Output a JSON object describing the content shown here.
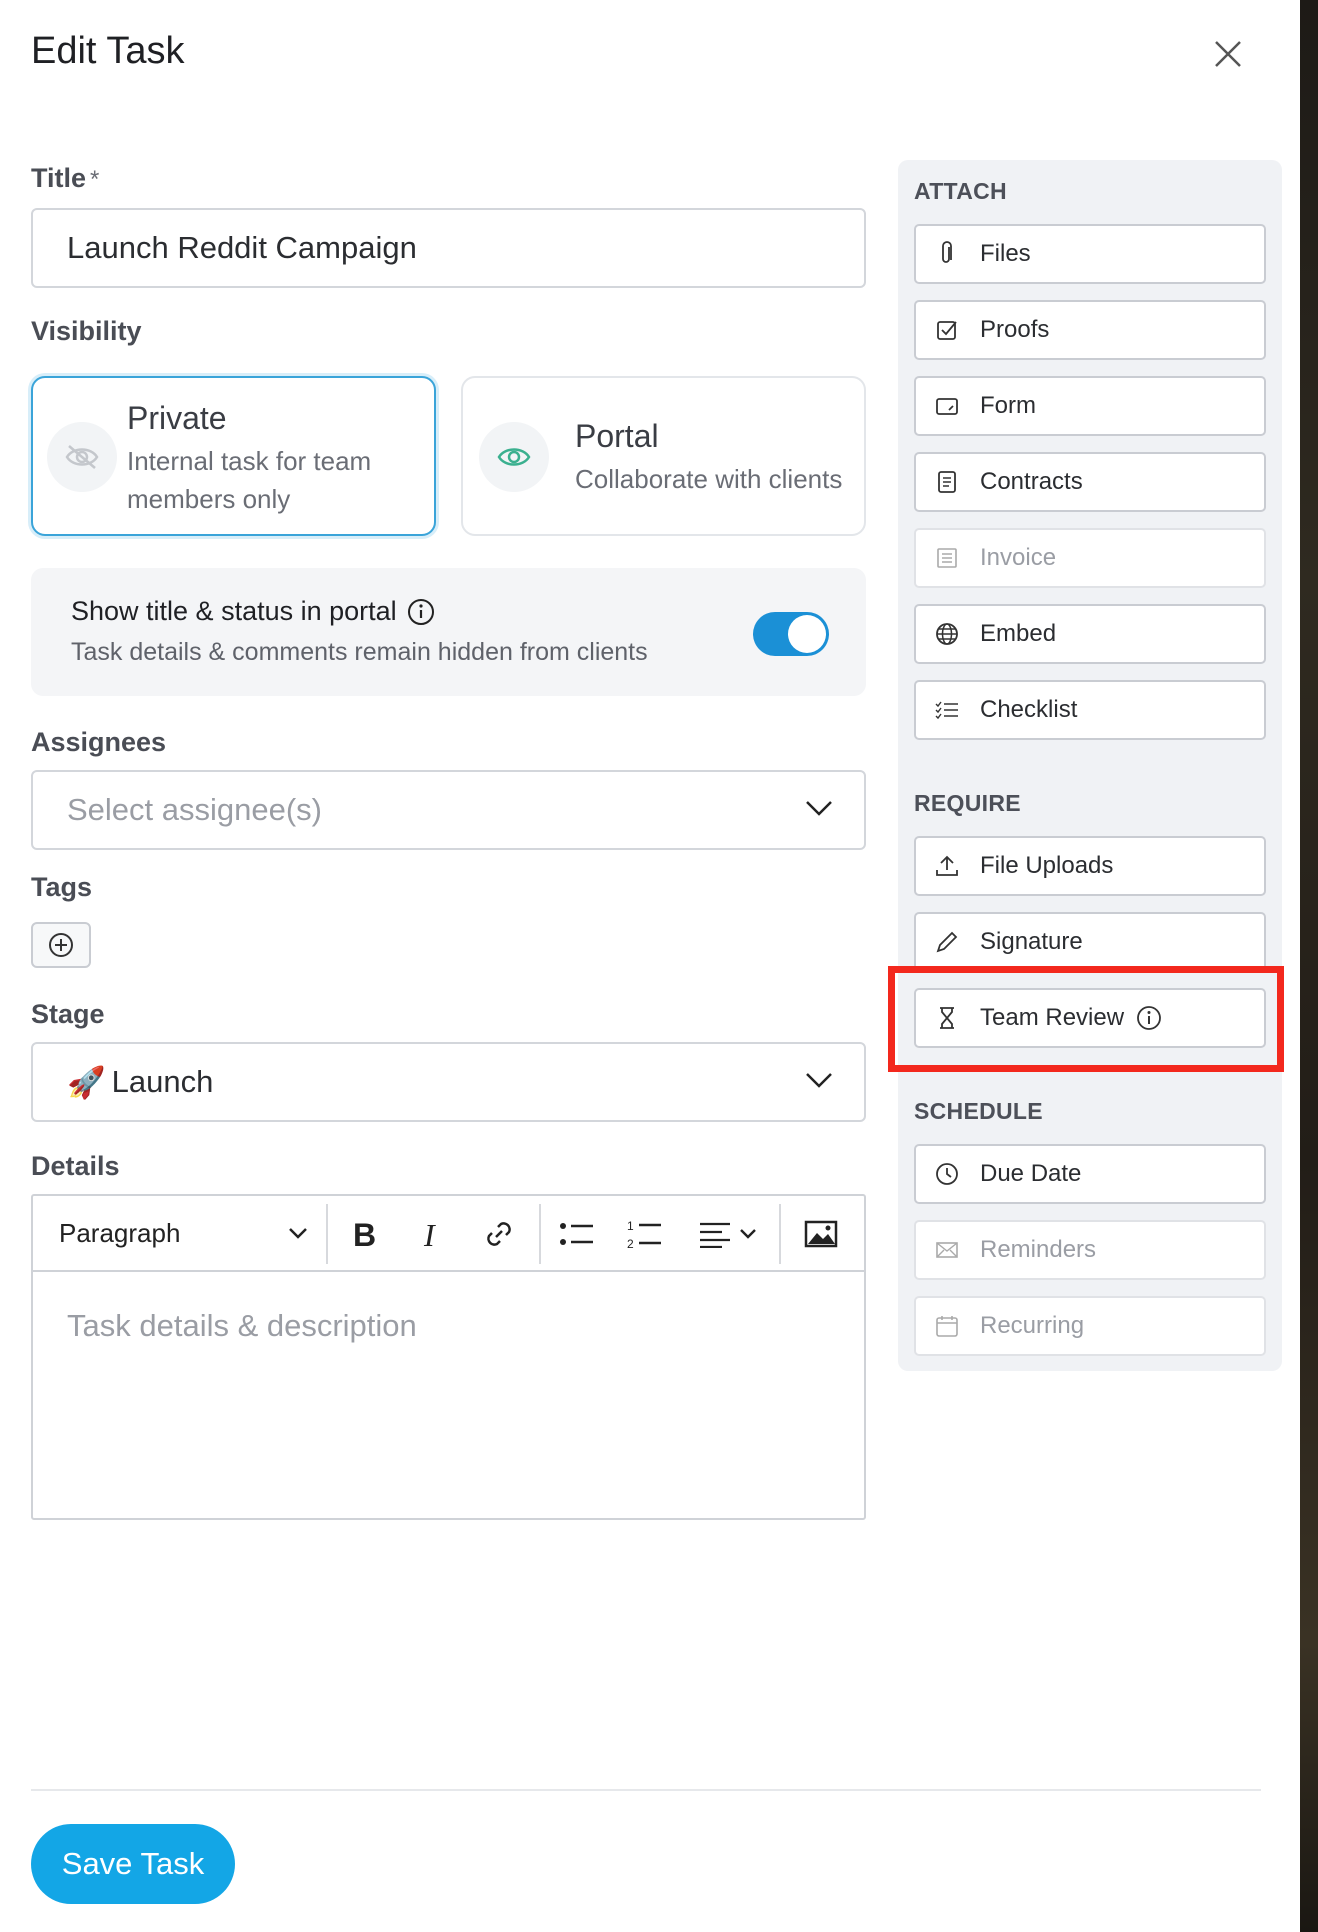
{
  "header": {
    "title": "Edit Task"
  },
  "form": {
    "title_label": "Title",
    "title_required": "*",
    "title_value": "Launch Reddit Campaign",
    "visibility_label": "Visibility",
    "visibility_options": [
      {
        "title": "Private",
        "subtitle_line1": "Internal task for team",
        "subtitle_line2": "members only",
        "selected": true
      },
      {
        "title": "Portal",
        "subtitle_line1": "Collaborate with clients",
        "selected": false
      }
    ],
    "portal_toggle": {
      "title": "Show title & status in portal",
      "subtitle": "Task details & comments remain hidden from clients",
      "on": true
    },
    "assignees_label": "Assignees",
    "assignees_placeholder": "Select assignee(s)",
    "tags_label": "Tags",
    "stage_label": "Stage",
    "stage_emoji": "🚀",
    "stage_value": "Launch",
    "details_label": "Details",
    "editor": {
      "block_format": "Paragraph",
      "placeholder": "Task details & description"
    }
  },
  "footer": {
    "save_label": "Save Task"
  },
  "sidebar": {
    "attach_heading": "ATTACH",
    "attach_items": [
      {
        "label": "Files",
        "icon": "paperclip-icon",
        "enabled": true
      },
      {
        "label": "Proofs",
        "icon": "proof-check-icon",
        "enabled": true
      },
      {
        "label": "Form",
        "icon": "form-icon",
        "enabled": true
      },
      {
        "label": "Contracts",
        "icon": "document-icon",
        "enabled": true
      },
      {
        "label": "Invoice",
        "icon": "invoice-icon",
        "enabled": false
      },
      {
        "label": "Embed",
        "icon": "globe-icon",
        "enabled": true
      },
      {
        "label": "Checklist",
        "icon": "checklist-icon",
        "enabled": true
      }
    ],
    "require_heading": "REQUIRE",
    "require_items": [
      {
        "label": "File Uploads",
        "icon": "upload-icon",
        "enabled": true
      },
      {
        "label": "Signature",
        "icon": "pen-icon",
        "enabled": true
      },
      {
        "label": "Team Review",
        "icon": "hourglass-icon",
        "enabled": true,
        "highlighted": true
      }
    ],
    "schedule_heading": "SCHEDULE",
    "schedule_items": [
      {
        "label": "Due Date",
        "icon": "clock-icon",
        "enabled": true
      },
      {
        "label": "Reminders",
        "icon": "envelope-icon",
        "enabled": false
      },
      {
        "label": "Recurring",
        "icon": "calendar-icon",
        "enabled": false
      }
    ]
  },
  "colors": {
    "accent": "#13a6e6",
    "toggle_on": "#1b90d6",
    "highlight": "#f3281d",
    "portal_icon": "#3bb08f"
  }
}
